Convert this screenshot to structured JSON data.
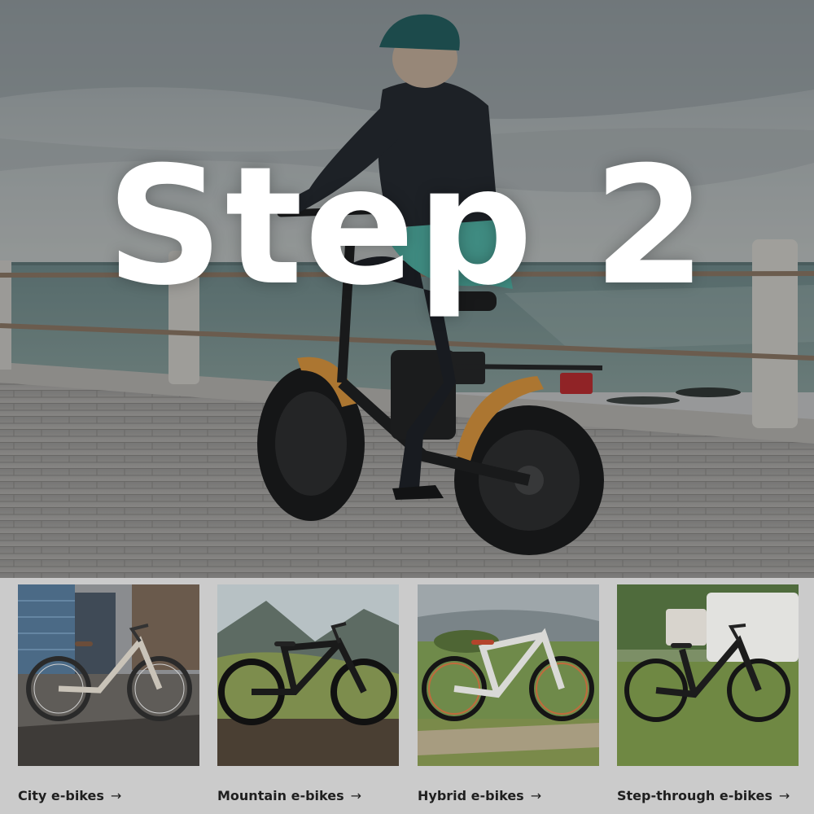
{
  "hero": {
    "title": "Step 2",
    "image_icon": "woman-riding-fat-tire-ebike-on-seaside-promenade"
  },
  "categories": [
    {
      "label": "City e-bikes",
      "arrow": "→",
      "icon": "city-ebike-photo"
    },
    {
      "label": "Mountain e-bikes",
      "arrow": "→",
      "icon": "mountain-ebike-photo"
    },
    {
      "label": "Hybrid e-bikes",
      "arrow": "→",
      "icon": "hybrid-ebike-photo"
    },
    {
      "label": "Step-through e-bikes",
      "arrow": "→",
      "icon": "step-through-ebike-photo"
    }
  ],
  "colors": {
    "strip_background": "#cbcbcb",
    "label_text": "#1f1f1f",
    "hero_text": "#ffffff",
    "fender_accent": "#e79a3a"
  }
}
